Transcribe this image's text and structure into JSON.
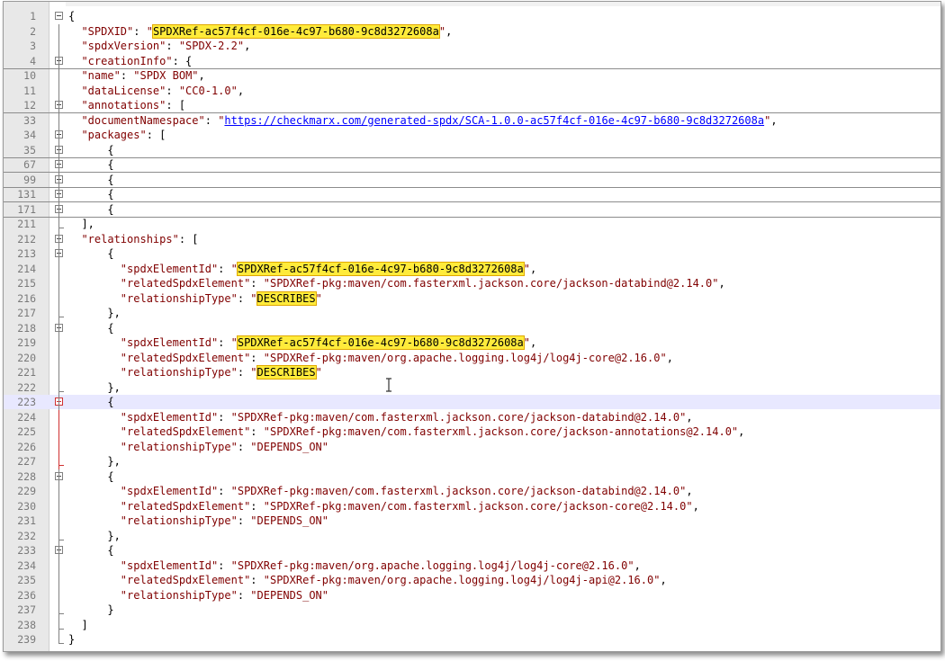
{
  "lines": [
    {
      "n": "1",
      "fold": "minus",
      "fc": false,
      "cur": false,
      "t": [
        [
          "p",
          "{"
        ]
      ]
    },
    {
      "n": "2",
      "fold": "",
      "fc": false,
      "cur": false,
      "t": [
        [
          "p",
          "  "
        ],
        [
          "k",
          "\"SPDXID\""
        ],
        [
          "p",
          ": "
        ],
        [
          "s",
          "\""
        ],
        [
          "hl",
          "SPDXRef-ac57f4cf-016e-4c97-b680-9c8d3272608a"
        ],
        [
          "s",
          "\""
        ],
        [
          "p",
          ","
        ]
      ]
    },
    {
      "n": "3",
      "fold": "",
      "fc": false,
      "cur": false,
      "t": [
        [
          "p",
          "  "
        ],
        [
          "k",
          "\"spdxVersion\""
        ],
        [
          "p",
          ": "
        ],
        [
          "s",
          "\"SPDX-2.2\""
        ],
        [
          "p",
          ","
        ]
      ]
    },
    {
      "n": "4",
      "fold": "plus",
      "fc": true,
      "cur": false,
      "t": [
        [
          "p",
          "  "
        ],
        [
          "k",
          "\"creationInfo\""
        ],
        [
          "p",
          ": {"
        ]
      ]
    },
    {
      "n": "10",
      "fold": "",
      "fc": false,
      "cur": false,
      "t": [
        [
          "p",
          "  "
        ],
        [
          "k",
          "\"name\""
        ],
        [
          "p",
          ": "
        ],
        [
          "s",
          "\"SPDX BOM\""
        ],
        [
          "p",
          ","
        ]
      ]
    },
    {
      "n": "11",
      "fold": "",
      "fc": false,
      "cur": false,
      "t": [
        [
          "p",
          "  "
        ],
        [
          "k",
          "\"dataLicense\""
        ],
        [
          "p",
          ": "
        ],
        [
          "s",
          "\"CC0-1.0\""
        ],
        [
          "p",
          ","
        ]
      ]
    },
    {
      "n": "12",
      "fold": "plus",
      "fc": true,
      "cur": false,
      "t": [
        [
          "p",
          "  "
        ],
        [
          "k",
          "\"annotations\""
        ],
        [
          "p",
          ": ["
        ]
      ]
    },
    {
      "n": "33",
      "fold": "",
      "fc": false,
      "cur": false,
      "t": [
        [
          "p",
          "  "
        ],
        [
          "k",
          "\"documentNamespace\""
        ],
        [
          "p",
          ": "
        ],
        [
          "s",
          "\""
        ],
        [
          "u",
          "https://checkmarx.com/generated-spdx/SCA-1.0.0-ac57f4cf-016e-4c97-b680-9c8d3272608a"
        ],
        [
          "s",
          "\""
        ],
        [
          "p",
          ","
        ]
      ]
    },
    {
      "n": "34",
      "fold": "minus",
      "fc": false,
      "cur": false,
      "t": [
        [
          "p",
          "  "
        ],
        [
          "k",
          "\"packages\""
        ],
        [
          "p",
          ": ["
        ]
      ]
    },
    {
      "n": "35",
      "fold": "plus",
      "fc": true,
      "cur": false,
      "t": [
        [
          "p",
          "      {"
        ]
      ]
    },
    {
      "n": "67",
      "fold": "plus",
      "fc": true,
      "cur": false,
      "t": [
        [
          "p",
          "      {"
        ]
      ]
    },
    {
      "n": "99",
      "fold": "plus",
      "fc": true,
      "cur": false,
      "t": [
        [
          "p",
          "      {"
        ]
      ]
    },
    {
      "n": "131",
      "fold": "plus",
      "fc": true,
      "cur": false,
      "t": [
        [
          "p",
          "      {"
        ]
      ]
    },
    {
      "n": "171",
      "fold": "plus",
      "fc": true,
      "cur": false,
      "t": [
        [
          "p",
          "      {"
        ]
      ]
    },
    {
      "n": "211",
      "fold": "end",
      "fc": false,
      "cur": false,
      "t": [
        [
          "p",
          "  ],"
        ]
      ]
    },
    {
      "n": "212",
      "fold": "minus",
      "fc": false,
      "cur": false,
      "t": [
        [
          "p",
          "  "
        ],
        [
          "k",
          "\"relationships\""
        ],
        [
          "p",
          ": ["
        ]
      ]
    },
    {
      "n": "213",
      "fold": "minus",
      "fc": false,
      "cur": false,
      "t": [
        [
          "p",
          "      {"
        ]
      ]
    },
    {
      "n": "214",
      "fold": "",
      "fc": false,
      "cur": false,
      "t": [
        [
          "p",
          "        "
        ],
        [
          "k",
          "\"spdxElementId\""
        ],
        [
          "p",
          ": "
        ],
        [
          "s",
          "\""
        ],
        [
          "hl",
          "SPDXRef-ac57f4cf-016e-4c97-b680-9c8d3272608a"
        ],
        [
          "s",
          "\""
        ],
        [
          "p",
          ","
        ]
      ]
    },
    {
      "n": "215",
      "fold": "",
      "fc": false,
      "cur": false,
      "t": [
        [
          "p",
          "        "
        ],
        [
          "k",
          "\"relatedSpdxElement\""
        ],
        [
          "p",
          ": "
        ],
        [
          "s",
          "\"SPDXRef-pkg:maven/com.fasterxml.jackson.core/jackson-databind@2.14.0\""
        ],
        [
          "p",
          ","
        ]
      ]
    },
    {
      "n": "216",
      "fold": "",
      "fc": false,
      "cur": false,
      "t": [
        [
          "p",
          "        "
        ],
        [
          "k",
          "\"relationshipType\""
        ],
        [
          "p",
          ": "
        ],
        [
          "s",
          "\""
        ],
        [
          "hl",
          "DESCRIBES"
        ],
        [
          "s",
          "\""
        ]
      ]
    },
    {
      "n": "217",
      "fold": "end",
      "fc": false,
      "cur": false,
      "t": [
        [
          "p",
          "      },"
        ]
      ]
    },
    {
      "n": "218",
      "fold": "minus",
      "fc": false,
      "cur": false,
      "t": [
        [
          "p",
          "      {"
        ]
      ]
    },
    {
      "n": "219",
      "fold": "",
      "fc": false,
      "cur": false,
      "t": [
        [
          "p",
          "        "
        ],
        [
          "k",
          "\"spdxElementId\""
        ],
        [
          "p",
          ": "
        ],
        [
          "s",
          "\""
        ],
        [
          "hl",
          "SPDXRef-ac57f4cf-016e-4c97-b680-9c8d3272608a"
        ],
        [
          "s",
          "\""
        ],
        [
          "p",
          ","
        ]
      ]
    },
    {
      "n": "220",
      "fold": "",
      "fc": false,
      "cur": false,
      "t": [
        [
          "p",
          "        "
        ],
        [
          "k",
          "\"relatedSpdxElement\""
        ],
        [
          "p",
          ": "
        ],
        [
          "s",
          "\"SPDXRef-pkg:maven/org.apache.logging.log4j/log4j-core@2.16.0\""
        ],
        [
          "p",
          ","
        ]
      ]
    },
    {
      "n": "221",
      "fold": "",
      "fc": false,
      "cur": false,
      "t": [
        [
          "p",
          "        "
        ],
        [
          "k",
          "\"relationshipType\""
        ],
        [
          "p",
          ": "
        ],
        [
          "s",
          "\""
        ],
        [
          "hl",
          "DESCRIBES"
        ],
        [
          "s",
          "\""
        ]
      ]
    },
    {
      "n": "222",
      "fold": "end",
      "fc": false,
      "cur": false,
      "t": [
        [
          "p",
          "      },"
        ]
      ]
    },
    {
      "n": "223",
      "fold": "minusred",
      "fc": false,
      "cur": true,
      "t": [
        [
          "p",
          "      {"
        ]
      ]
    },
    {
      "n": "224",
      "fold": "",
      "fc": false,
      "cur": false,
      "t": [
        [
          "p",
          "        "
        ],
        [
          "k",
          "\"spdxElementId\""
        ],
        [
          "p",
          ": "
        ],
        [
          "s",
          "\"SPDXRef-pkg:maven/com.fasterxml.jackson.core/jackson-databind@2.14.0\""
        ],
        [
          "p",
          ","
        ]
      ]
    },
    {
      "n": "225",
      "fold": "",
      "fc": false,
      "cur": false,
      "t": [
        [
          "p",
          "        "
        ],
        [
          "k",
          "\"relatedSpdxElement\""
        ],
        [
          "p",
          ": "
        ],
        [
          "s",
          "\"SPDXRef-pkg:maven/com.fasterxml.jackson.core/jackson-annotations@2.14.0\""
        ],
        [
          "p",
          ","
        ]
      ]
    },
    {
      "n": "226",
      "fold": "",
      "fc": false,
      "cur": false,
      "t": [
        [
          "p",
          "        "
        ],
        [
          "k",
          "\"relationshipType\""
        ],
        [
          "p",
          ": "
        ],
        [
          "s",
          "\"DEPENDS_ON\""
        ]
      ]
    },
    {
      "n": "227",
      "fold": "endred",
      "fc": false,
      "cur": false,
      "t": [
        [
          "p",
          "      },"
        ]
      ]
    },
    {
      "n": "228",
      "fold": "minus",
      "fc": false,
      "cur": false,
      "t": [
        [
          "p",
          "      {"
        ]
      ]
    },
    {
      "n": "229",
      "fold": "",
      "fc": false,
      "cur": false,
      "t": [
        [
          "p",
          "        "
        ],
        [
          "k",
          "\"spdxElementId\""
        ],
        [
          "p",
          ": "
        ],
        [
          "s",
          "\"SPDXRef-pkg:maven/com.fasterxml.jackson.core/jackson-databind@2.14.0\""
        ],
        [
          "p",
          ","
        ]
      ]
    },
    {
      "n": "230",
      "fold": "",
      "fc": false,
      "cur": false,
      "t": [
        [
          "p",
          "        "
        ],
        [
          "k",
          "\"relatedSpdxElement\""
        ],
        [
          "p",
          ": "
        ],
        [
          "s",
          "\"SPDXRef-pkg:maven/com.fasterxml.jackson.core/jackson-core@2.14.0\""
        ],
        [
          "p",
          ","
        ]
      ]
    },
    {
      "n": "231",
      "fold": "",
      "fc": false,
      "cur": false,
      "t": [
        [
          "p",
          "        "
        ],
        [
          "k",
          "\"relationshipType\""
        ],
        [
          "p",
          ": "
        ],
        [
          "s",
          "\"DEPENDS_ON\""
        ]
      ]
    },
    {
      "n": "232",
      "fold": "end",
      "fc": false,
      "cur": false,
      "t": [
        [
          "p",
          "      },"
        ]
      ]
    },
    {
      "n": "233",
      "fold": "minus",
      "fc": false,
      "cur": false,
      "t": [
        [
          "p",
          "      {"
        ]
      ]
    },
    {
      "n": "234",
      "fold": "",
      "fc": false,
      "cur": false,
      "t": [
        [
          "p",
          "        "
        ],
        [
          "k",
          "\"spdxElementId\""
        ],
        [
          "p",
          ": "
        ],
        [
          "s",
          "\"SPDXRef-pkg:maven/org.apache.logging.log4j/log4j-core@2.16.0\""
        ],
        [
          "p",
          ","
        ]
      ]
    },
    {
      "n": "235",
      "fold": "",
      "fc": false,
      "cur": false,
      "t": [
        [
          "p",
          "        "
        ],
        [
          "k",
          "\"relatedSpdxElement\""
        ],
        [
          "p",
          ": "
        ],
        [
          "s",
          "\"SPDXRef-pkg:maven/org.apache.logging.log4j/log4j-api@2.16.0\""
        ],
        [
          "p",
          ","
        ]
      ]
    },
    {
      "n": "236",
      "fold": "",
      "fc": false,
      "cur": false,
      "t": [
        [
          "p",
          "        "
        ],
        [
          "k",
          "\"relationshipType\""
        ],
        [
          "p",
          ": "
        ],
        [
          "s",
          "\"DEPENDS_ON\""
        ]
      ]
    },
    {
      "n": "237",
      "fold": "end",
      "fc": false,
      "cur": false,
      "t": [
        [
          "p",
          "      }"
        ]
      ]
    },
    {
      "n": "238",
      "fold": "end",
      "fc": false,
      "cur": false,
      "t": [
        [
          "p",
          "  ]"
        ]
      ]
    },
    {
      "n": "239",
      "fold": "endlast",
      "fc": false,
      "cur": false,
      "t": [
        [
          "p",
          "}"
        ]
      ]
    }
  ],
  "cursor_icon": "text-cursor-icon"
}
